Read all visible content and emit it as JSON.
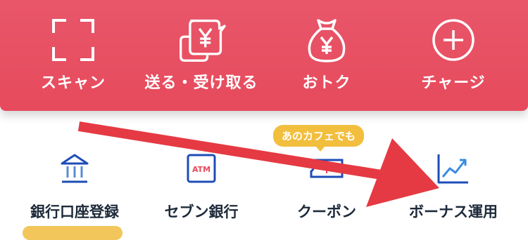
{
  "top_actions": [
    {
      "label": "スキャン",
      "icon": "scan-icon"
    },
    {
      "label": "送る・受け取る",
      "icon": "send-receive-icon"
    },
    {
      "label": "おトク",
      "icon": "money-bag-icon"
    },
    {
      "label": "チャージ",
      "icon": "plus-circle-icon"
    }
  ],
  "bottom_actions": [
    {
      "label": "銀行口座登録",
      "icon": "bank-icon"
    },
    {
      "label": "セブン銀行",
      "icon": "atm-icon",
      "icon_text": "ATM"
    },
    {
      "label": "クーポン",
      "icon": "coupon-icon",
      "badge": "あのカフェでも"
    },
    {
      "label": "ボーナス運用",
      "icon": "chart-icon"
    }
  ],
  "annotation": {
    "type": "arrow",
    "color": "#e53a43"
  },
  "colors": {
    "header": "#e64a5c",
    "badge": "#f2be3e",
    "icon_blue": "#1e4db7",
    "label_dark": "#1d2a3a"
  }
}
